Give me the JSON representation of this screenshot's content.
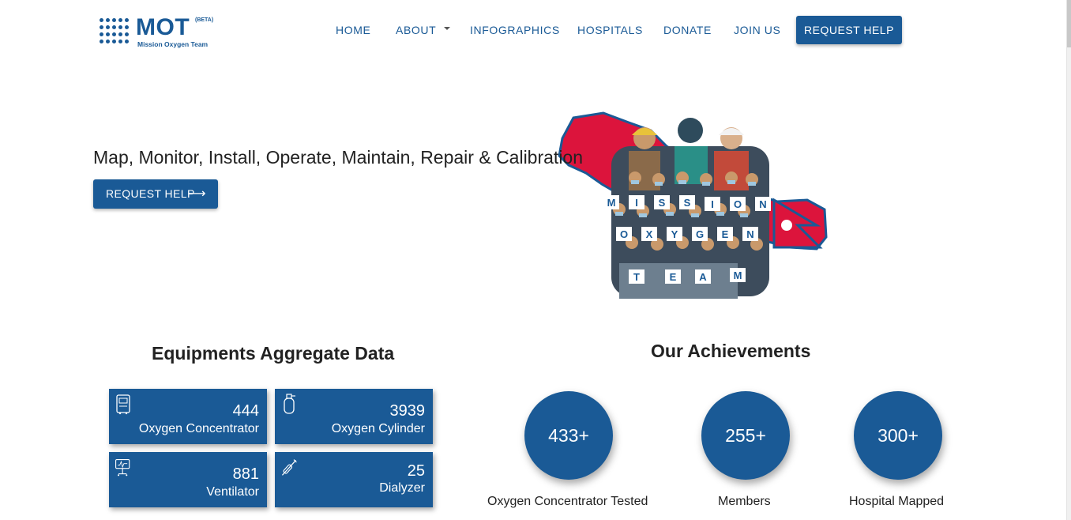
{
  "brand": {
    "name": "MOT",
    "tag": "(BETA)",
    "subtitle": "Mission Oxygen Team"
  },
  "nav": {
    "items": [
      {
        "label": "HOME"
      },
      {
        "label": "ABOUT",
        "dropdown": true
      },
      {
        "label": "INFOGRAPHICS"
      },
      {
        "label": "HOSPITALS"
      },
      {
        "label": "DONATE"
      },
      {
        "label": "JOIN US"
      }
    ],
    "cta": "REQUEST HELP"
  },
  "hero": {
    "headline": "Map, Monitor, Install, Operate, Maintain, Repair & Calibration",
    "button": "REQUEST HELP",
    "button_icon": "arrow-right-icon",
    "banner_letters": {
      "row1": "MISSION",
      "row2": "OXYGEN",
      "row3": "TEAM"
    }
  },
  "equipment": {
    "title": "Equipments Aggregate Data",
    "cards": [
      {
        "value": "444",
        "label": "Oxygen Concentrator",
        "icon": "oxygen-concentrator-icon"
      },
      {
        "value": "3939",
        "label": "Oxygen Cylinder",
        "icon": "oxygen-cylinder-icon"
      },
      {
        "value": "881",
        "label": "Ventilator",
        "icon": "ventilator-icon"
      },
      {
        "value": "25",
        "label": "Dialyzer",
        "icon": "dialyzer-icon"
      }
    ]
  },
  "achievements": {
    "title": "Our Achievements",
    "items": [
      {
        "value": "433+",
        "label": "Oxygen Concentrator Tested"
      },
      {
        "value": "255+",
        "label": "Members"
      },
      {
        "value": "300+",
        "label": "Hospital Mapped"
      }
    ]
  },
  "colors": {
    "primary": "#1a5a96",
    "flag_red": "#dc143c",
    "text": "#222222"
  }
}
